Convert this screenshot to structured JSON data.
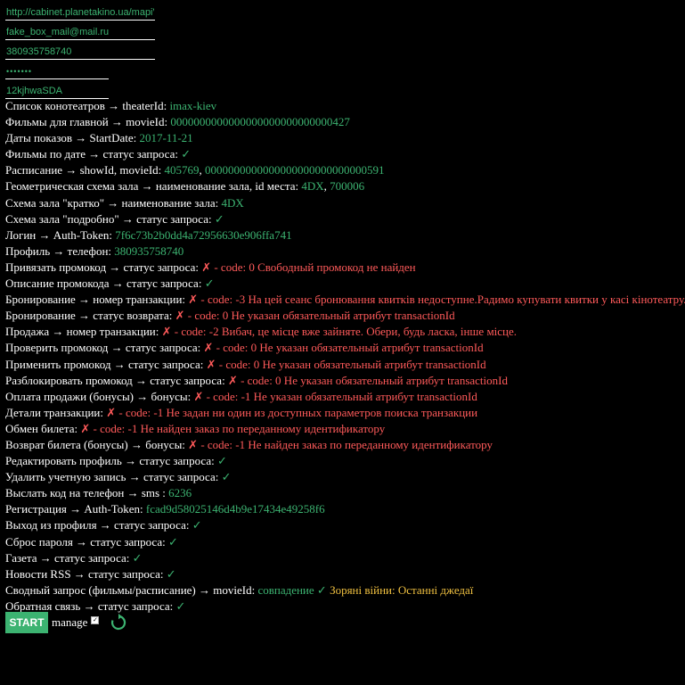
{
  "inputs": {
    "url": "http://cabinet.planetakino.ua/mapiV2",
    "email": "fake_box_mail@mail.ru",
    "phone": "380935758740",
    "password": "•••••••",
    "code": "12kjhwaSDA"
  },
  "rows": [
    {
      "label": "Список конотеатров → theaterId:",
      "parts": [
        {
          "text": " imax-kiev",
          "color": "g"
        }
      ]
    },
    {
      "label": "Фильмы для главной → movieId:",
      "parts": [
        {
          "text": " 0000000000000000000000000000427",
          "color": "g"
        }
      ]
    },
    {
      "label": "Даты показов → StartDate:",
      "parts": [
        {
          "text": " 2017-11-21",
          "color": "g"
        }
      ]
    },
    {
      "label": "Фильмы по дате → статус запроса:",
      "parts": [
        {
          "text": " ✓",
          "color": "g"
        }
      ]
    },
    {
      "label": "Расписание → showId, movieId:",
      "parts": [
        {
          "text": " 405769",
          "color": "g"
        },
        {
          "text": ", ",
          "color": "w"
        },
        {
          "text": "0000000000000000000000000000591",
          "color": "g"
        }
      ]
    },
    {
      "label": "Геометрическая схема зала → наименование зала, id места:",
      "parts": [
        {
          "text": " 4DX",
          "color": "g"
        },
        {
          "text": ", ",
          "color": "w"
        },
        {
          "text": "700006",
          "color": "g"
        }
      ]
    },
    {
      "label": "Схема зала \"кратко\" → наименование зала:",
      "parts": [
        {
          "text": " 4DX",
          "color": "g"
        }
      ]
    },
    {
      "label": "Схема зала \"подробно\" → статус запроса:",
      "parts": [
        {
          "text": " ✓",
          "color": "g"
        }
      ]
    },
    {
      "label": "Логин → Auth-Token:",
      "parts": [
        {
          "text": " 7f6c73b2b0dd4a72956630e906ffa741",
          "color": "g"
        }
      ]
    },
    {
      "label": "Профиль → телефон:",
      "parts": [
        {
          "text": " 380935758740",
          "color": "g"
        }
      ]
    },
    {
      "label": "Привязать промокод → статус запроса:",
      "parts": [
        {
          "text": " ✗ - code: 0 Свободный промокод не найден",
          "color": "r"
        }
      ]
    },
    {
      "label": "Описание промокода → статус запроса:",
      "parts": [
        {
          "text": " ✓",
          "color": "g"
        }
      ]
    },
    {
      "label": "Бронирование → номер транзакции:",
      "parts": [
        {
          "text": " ✗ - code: -3 На цей сеанс бронювання квитків недоступне.Радимо купувати квитки у касі кінотеатру.",
          "color": "r"
        }
      ]
    },
    {
      "label": "Бронирование → статус возврата:",
      "parts": [
        {
          "text": " ✗ - code: 0 Не указан обязательный атрибут transactionId",
          "color": "r"
        }
      ]
    },
    {
      "label": "Продажа → номер транзакции:",
      "parts": [
        {
          "text": " ✗ - code: -2 Вибач, це місце вже зайняте. Обери, будь ласка, інше місце.",
          "color": "r"
        }
      ]
    },
    {
      "label": "Проверить промокод → статус запроса:",
      "parts": [
        {
          "text": " ✗ - code: 0 Не указан обязательный атрибут transactionId",
          "color": "r"
        }
      ]
    },
    {
      "label": "Применить промокод → статус запроса:",
      "parts": [
        {
          "text": " ✗ - code: 0 Не указан обязательный атрибут transactionId",
          "color": "r"
        }
      ]
    },
    {
      "label": "Разблокировать промокод → статус запроса:",
      "parts": [
        {
          "text": " ✗ - code: 0 Не указан обязательный атрибут transactionId",
          "color": "r"
        }
      ]
    },
    {
      "label": "Оплата продажи (бонусы) → бонусы:",
      "parts": [
        {
          "text": " ✗ - code: -1 Не указан обязательный атрибут transactionId",
          "color": "r"
        }
      ]
    },
    {
      "label": "Детали транзакции:",
      "parts": [
        {
          "text": " ✗ - code: -1 Не задан ни один из доступных параметров поиска транзакции",
          "color": "r"
        }
      ]
    },
    {
      "label": "Обмен билета:",
      "parts": [
        {
          "text": " ✗ - code: -1 Не найден заказ по переданному идентификатору",
          "color": "r"
        }
      ]
    },
    {
      "label": "Возврат билета (бонусы) → бонусы:",
      "parts": [
        {
          "text": " ✗ - code: -1 Не найден заказ по переданному идентификатору",
          "color": "r"
        }
      ]
    },
    {
      "label": "Редактировать профиль → статус запроса:",
      "parts": [
        {
          "text": " ✓",
          "color": "g"
        }
      ]
    },
    {
      "label": "Удалить учетную запись → статус запроса:",
      "parts": [
        {
          "text": " ✓",
          "color": "g"
        }
      ]
    },
    {
      "label": "Выслать код на телефон → sms :",
      "parts": [
        {
          "text": " 6236",
          "color": "g"
        }
      ]
    },
    {
      "label": "Регистрация → Auth-Token:",
      "parts": [
        {
          "text": " fcad9d58025146d4b9e17434e49258f6",
          "color": "g"
        }
      ]
    },
    {
      "label": "Выход из профиля → статус запроса:",
      "parts": [
        {
          "text": " ✓",
          "color": "g"
        }
      ]
    },
    {
      "label": "Сброс пароля → статус запроса:",
      "parts": [
        {
          "text": " ✓",
          "color": "g"
        }
      ]
    },
    {
      "label": "Газета → статус запроса:",
      "parts": [
        {
          "text": " ✓",
          "color": "g"
        }
      ]
    },
    {
      "label": "Новости RSS → статус запроса:",
      "parts": [
        {
          "text": " ✓",
          "color": "g"
        }
      ]
    },
    {
      "label": "Сводный запрос (фильмы/расписание) → movieId:",
      "parts": [
        {
          "text": " совпадение ✓",
          "color": "g"
        },
        {
          "text": " Зоряні війни: Останні джедаї",
          "color": "y"
        }
      ]
    },
    {
      "label": "Обратная связь → статус запроса:",
      "parts": [
        {
          "text": " ✓",
          "color": "g"
        }
      ]
    }
  ],
  "controls": {
    "start_label": "START",
    "manage_label": "manage",
    "manage_checked": true,
    "refresh_icon": "refresh-icon"
  },
  "colors": {
    "accent": "#3cb371",
    "error": "#ff5a5a",
    "highlight": "#f0c040",
    "background": "#000000"
  }
}
